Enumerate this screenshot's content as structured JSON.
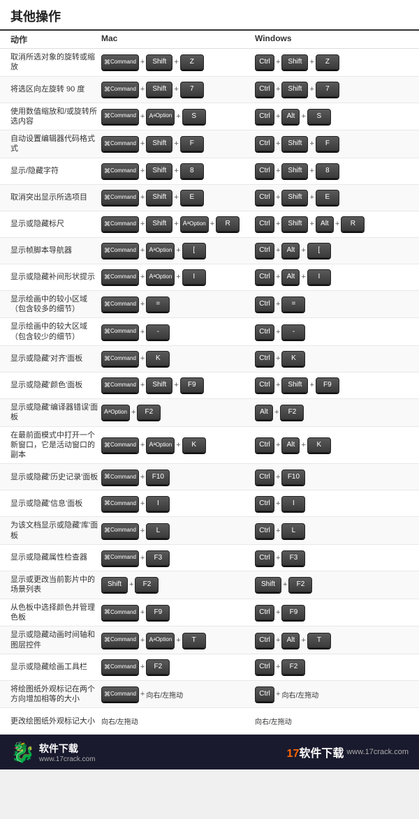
{
  "title": "其他操作",
  "columns": {
    "action": "动作",
    "mac": "Mac",
    "windows": "Windows"
  },
  "rows": [
    {
      "action": "取消所选对象的旋转或缩放",
      "mac": [
        [
          "Command",
          "cmd"
        ],
        "+",
        [
          "Shift",
          "shift"
        ],
        "+",
        [
          "Z",
          "z"
        ]
      ],
      "win": [
        [
          "Ctrl",
          "ctrl"
        ],
        "+",
        [
          "Shift",
          "shift"
        ],
        "+",
        [
          "Z",
          "z"
        ]
      ]
    },
    {
      "action": "将选区向左旋转 90 度",
      "mac": [
        [
          "Command",
          "cmd"
        ],
        "+",
        [
          "Shift",
          "shift"
        ],
        "+",
        [
          "7",
          "7"
        ]
      ],
      "win": [
        [
          "Ctrl",
          "ctrl"
        ],
        "+",
        [
          "Shift",
          "shift"
        ],
        "+",
        [
          "7",
          "7"
        ]
      ]
    },
    {
      "action": "使用数值缩放和/或旋转所选内容",
      "mac": [
        [
          "Command",
          "cmd"
        ],
        "+",
        [
          "Option",
          "opt"
        ],
        "+",
        [
          "S",
          "s"
        ]
      ],
      "win": [
        [
          "Ctrl",
          "ctrl"
        ],
        "+",
        [
          "Alt",
          "alt"
        ],
        "+",
        [
          "S",
          "s"
        ]
      ]
    },
    {
      "action": "自动设置编辑器代码格式式",
      "mac": [
        [
          "Command",
          "cmd"
        ],
        "+",
        [
          "Shift",
          "shift"
        ],
        "+",
        [
          "F",
          "f"
        ]
      ],
      "win": [
        [
          "Ctrl",
          "ctrl"
        ],
        "+",
        [
          "Shift",
          "shift"
        ],
        "+",
        [
          "F",
          "f"
        ]
      ]
    },
    {
      "action": "显示/隐藏字符",
      "mac": [
        [
          "Command",
          "cmd"
        ],
        "+",
        [
          "Shift",
          "shift"
        ],
        "+",
        [
          "8",
          "8"
        ]
      ],
      "win": [
        [
          "Ctrl",
          "ctrl"
        ],
        "+",
        [
          "Shift",
          "shift"
        ],
        "+",
        [
          "8",
          "8"
        ]
      ]
    },
    {
      "action": "取消突出显示所选项目",
      "mac": [
        [
          "Command",
          "cmd"
        ],
        "+",
        [
          "Shift",
          "shift"
        ],
        "+",
        [
          "E",
          "e"
        ]
      ],
      "win": [
        [
          "Ctrl",
          "ctrl"
        ],
        "+",
        [
          "Shift",
          "shift"
        ],
        "+",
        [
          "E",
          "e"
        ]
      ]
    },
    {
      "action": "显示或隐藏标尺",
      "mac": [
        [
          "Command",
          "cmd"
        ],
        "+",
        [
          "Shift",
          "shift"
        ],
        "+",
        [
          "Option",
          "opt"
        ],
        "+",
        [
          "R",
          "r"
        ]
      ],
      "win": [
        [
          "Ctrl",
          "ctrl"
        ],
        "+",
        [
          "Shift",
          "shift"
        ],
        "+",
        [
          "Alt",
          "alt"
        ],
        "+",
        [
          "R",
          "r"
        ]
      ]
    },
    {
      "action": "显示帧脚本导航器",
      "mac": [
        [
          "Command",
          "cmd"
        ],
        "+",
        [
          "Option",
          "opt"
        ],
        "+",
        [
          "[",
          "["
        ]
      ],
      "win": [
        [
          "Ctrl",
          "ctrl"
        ],
        "+",
        [
          "Alt",
          "alt"
        ],
        "+",
        [
          "[",
          "["
        ]
      ]
    },
    {
      "action": "显示或隐藏补间形状提示",
      "mac": [
        [
          "Command",
          "cmd"
        ],
        "+",
        [
          "Option",
          "opt"
        ],
        "+",
        [
          "I",
          "i"
        ]
      ],
      "win": [
        [
          "Ctrl",
          "ctrl"
        ],
        "+",
        [
          "Alt",
          "alt"
        ],
        "+",
        [
          "I",
          "i"
        ]
      ]
    },
    {
      "action": "显示绘画中的较小区域（包含较多的细节）",
      "mac": [
        [
          "Command",
          "cmd"
        ],
        "+",
        [
          "=",
          "="
        ]
      ],
      "win": [
        [
          "Ctrl",
          "ctrl"
        ],
        "+",
        [
          "=",
          "="
        ]
      ]
    },
    {
      "action": "显示绘画中的较大区域（包含较少的细节）",
      "mac": [
        [
          "Command",
          "cmd"
        ],
        "+",
        [
          "-",
          "-"
        ]
      ],
      "win": [
        [
          "Ctrl",
          "ctrl"
        ],
        "+",
        [
          "-",
          "-"
        ]
      ]
    },
    {
      "action": "显示或隐藏'对齐'面板",
      "mac": [
        [
          "Command",
          "cmd"
        ],
        "+",
        [
          "K",
          "k"
        ]
      ],
      "win": [
        [
          "Ctrl",
          "ctrl"
        ],
        "+",
        [
          "K",
          "k"
        ]
      ]
    },
    {
      "action": "显示或隐藏'颜色'面板",
      "mac": [
        [
          "Command",
          "cmd"
        ],
        "+",
        [
          "Shift",
          "shift"
        ],
        "+",
        [
          "F9",
          "f9"
        ]
      ],
      "win": [
        [
          "Ctrl",
          "ctrl"
        ],
        "+",
        [
          "Shift",
          "shift"
        ],
        "+",
        [
          "F9",
          "f9"
        ]
      ]
    },
    {
      "action": "显示或隐藏'编译器错误'面板",
      "mac": [
        [
          "Option",
          "opt"
        ],
        "+",
        [
          "F2",
          "f2"
        ]
      ],
      "win": [
        [
          "Alt",
          "alt"
        ],
        "+",
        [
          "F2",
          "f2"
        ]
      ]
    },
    {
      "action": "在最前面模式中打开一个新窗口，它是活动窗口的副本",
      "mac": [
        [
          "Command",
          "cmd"
        ],
        "+",
        [
          "Option",
          "opt"
        ],
        "+",
        [
          "K",
          "k"
        ]
      ],
      "win": [
        [
          "Ctrl",
          "ctrl"
        ],
        "+",
        [
          "Alt",
          "alt"
        ],
        "+",
        [
          "K",
          "k"
        ]
      ]
    },
    {
      "action": "显示或隐藏'历史记录'面板",
      "mac": [
        [
          "Command",
          "cmd"
        ],
        "+",
        [
          "F10",
          "f10"
        ]
      ],
      "win": [
        [
          "Ctrl",
          "ctrl"
        ],
        "+",
        [
          "F10",
          "f10"
        ]
      ]
    },
    {
      "action": "显示或隐藏'信息'面板",
      "mac": [
        [
          "Command",
          "cmd"
        ],
        "+",
        [
          "I",
          "i"
        ]
      ],
      "win": [
        [
          "Ctrl",
          "ctrl"
        ],
        "+",
        [
          "I",
          "i"
        ]
      ]
    },
    {
      "action": "为该文档显示或隐藏'库'面板",
      "mac": [
        [
          "Command",
          "cmd"
        ],
        "+",
        [
          "L",
          "l"
        ]
      ],
      "win": [
        [
          "Ctrl",
          "ctrl"
        ],
        "+",
        [
          "L",
          "l"
        ]
      ]
    },
    {
      "action": "显示或隐藏属性检查器",
      "mac": [
        [
          "Command",
          "cmd"
        ],
        "+",
        [
          "F3",
          "f3"
        ]
      ],
      "win": [
        [
          "Ctrl",
          "ctrl"
        ],
        "+",
        [
          "F3",
          "f3"
        ]
      ]
    },
    {
      "action": "显示或更改当前影片中的场景列表",
      "mac": [
        [
          "Shift",
          "shift"
        ],
        "+",
        [
          "F2",
          "f2"
        ]
      ],
      "win": [
        [
          "Shift",
          "shift"
        ],
        "+",
        [
          "F2",
          "f2"
        ]
      ]
    },
    {
      "action": "从色板中选择颜色并管理色板",
      "mac": [
        [
          "Command",
          "cmd"
        ],
        "+",
        [
          "F9",
          "f9"
        ]
      ],
      "win": [
        [
          "Ctrl",
          "ctrl"
        ],
        "+",
        [
          "F9",
          "f9"
        ]
      ]
    },
    {
      "action": "显示或隐藏动画时间轴和图层控件",
      "mac": [
        [
          "Command",
          "cmd"
        ],
        "+",
        [
          "Option",
          "opt"
        ],
        "+",
        [
          "T",
          "t"
        ]
      ],
      "win": [
        [
          "Ctrl",
          "ctrl"
        ],
        "+",
        [
          "Alt",
          "alt"
        ],
        "+",
        [
          "T",
          "t"
        ]
      ]
    },
    {
      "action": "显示或隐藏绘画工具栏",
      "mac": [
        [
          "Command",
          "cmd"
        ],
        "+",
        [
          "F2",
          "f2"
        ]
      ],
      "win": [
        [
          "Ctrl",
          "ctrl"
        ],
        "+",
        [
          "F2",
          "f2"
        ]
      ]
    },
    {
      "action": "将绘图纸外观标记在两个方向增加相等的大小",
      "mac": [
        [
          "Command",
          "cmd"
        ],
        "+",
        "向右/左拖动"
      ],
      "win": [
        [
          "Ctrl",
          "ctrl"
        ],
        "+",
        "向右/左拖动"
      ]
    },
    {
      "action": "更改绘图纸外观标记大小",
      "mac": [
        "向右/左拖动"
      ],
      "win": [
        "向右/左拖动"
      ]
    }
  ],
  "footer": {
    "left_icon": "🐉",
    "left_title": "软件下载",
    "left_sub": "www.17crack.com",
    "right_brand": "17软件下载",
    "right_url": "www.17crack.com"
  }
}
